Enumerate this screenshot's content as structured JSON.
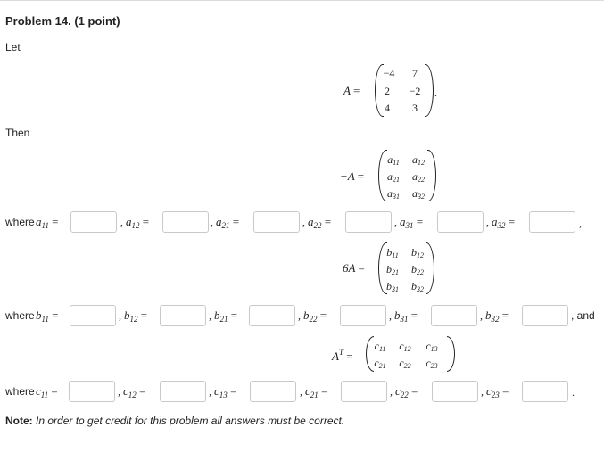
{
  "problem": {
    "title": "Problem 14.",
    "points": "(1 point)"
  },
  "text": {
    "let": "Let",
    "then": "Then",
    "where": "where",
    "and": ", and"
  },
  "matrix_A": {
    "label": "A",
    "rows": [
      [
        "−4",
        "7"
      ],
      [
        "2",
        "−2"
      ],
      [
        "4",
        "3"
      ]
    ],
    "trailing": "."
  },
  "matrix_negA": {
    "label": "−A",
    "rows": [
      [
        "a11",
        "a12"
      ],
      [
        "a21",
        "a22"
      ],
      [
        "a31",
        "a32"
      ]
    ]
  },
  "matrix_6A": {
    "label": "6A",
    "rows": [
      [
        "b11",
        "b12"
      ],
      [
        "b21",
        "b22"
      ],
      [
        "b31",
        "b32"
      ]
    ]
  },
  "matrix_AT": {
    "label": "A",
    "superscript": "T",
    "rows": [
      [
        "c11",
        "c12",
        "c13"
      ],
      [
        "c21",
        "c22",
        "c23"
      ]
    ]
  },
  "row_a": [
    "a11",
    "a12",
    "a21",
    "a22",
    "a31",
    "a32"
  ],
  "row_b": [
    "b11",
    "b12",
    "b21",
    "b22",
    "b31",
    "b32"
  ],
  "row_c": [
    "c11",
    "c12",
    "c13",
    "c21",
    "c22",
    "c23"
  ],
  "note": {
    "label": "Note:",
    "text": "In order to get credit for this problem all answers must be correct."
  }
}
